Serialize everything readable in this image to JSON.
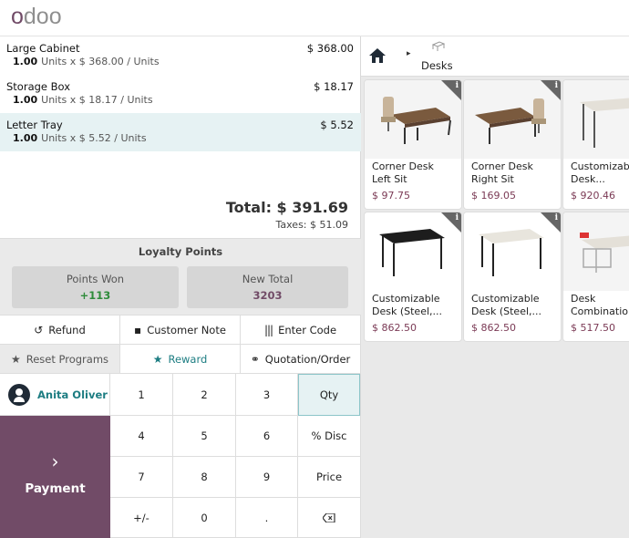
{
  "header": {
    "logo_text": "odoo"
  },
  "order": {
    "lines": [
      {
        "name": "Large Cabinet",
        "price": "$ 368.00",
        "qty": "1.00",
        "detail": "Units x $ 368.00 / Units"
      },
      {
        "name": "Storage Box",
        "price": "$ 18.17",
        "qty": "1.00",
        "detail": "Units x $ 18.17 / Units"
      },
      {
        "name": "Letter Tray",
        "price": "$ 5.52",
        "qty": "1.00",
        "detail": "Units x $ 5.52 / Units"
      }
    ],
    "total": "Total: $ 391.69",
    "taxes": "Taxes: $ 51.09"
  },
  "loyalty": {
    "title": "Loyalty Points",
    "points_won_label": "Points Won",
    "points_won_value": "+113",
    "new_total_label": "New Total",
    "new_total_value": "3203"
  },
  "controls": {
    "refund": "Refund",
    "customer_note": "Customer Note",
    "enter_code": "Enter Code",
    "reset_programs": "Reset Programs",
    "reward": "Reward",
    "quotation_order": "Quotation/Order"
  },
  "customer": {
    "name": "Anita Oliver"
  },
  "payment": {
    "label": "Payment"
  },
  "numpad": {
    "k1": "1",
    "k2": "2",
    "k3": "3",
    "qty": "Qty",
    "k4": "4",
    "k5": "5",
    "k6": "6",
    "disc": "% Disc",
    "k7": "7",
    "k8": "8",
    "k9": "9",
    "price": "Price",
    "plusminus": "+/-",
    "k0": "0",
    "dot": "."
  },
  "breadcrumb": {
    "category": "Desks"
  },
  "products": [
    {
      "name1": "Corner Desk",
      "name2": "Left Sit",
      "price": "$ 97.75"
    },
    {
      "name1": "Corner Desk",
      "name2": "Right Sit",
      "price": "$ 169.05"
    },
    {
      "name1": "Customizab",
      "name2": "Desk...",
      "price": "$ 920.46"
    },
    {
      "name1": "Customizable",
      "name2": "Desk (Steel,...",
      "price": "$ 862.50"
    },
    {
      "name1": "Customizable",
      "name2": "Desk (Steel,...",
      "price": "$ 862.50"
    },
    {
      "name1": "Desk",
      "name2": "Combinatio",
      "price": "$ 517.50"
    }
  ],
  "colors": {
    "brand": "#714b67",
    "teal": "#1d7d82",
    "points_won": "#2e8b3a",
    "new_total": "#714b67",
    "price": "#7b3a55",
    "selected_row": "#e6f2f3"
  },
  "icons": {
    "home": "home-icon",
    "refund": "undo-icon",
    "note": "note-icon",
    "code": "barcode-icon",
    "reset": "star-icon",
    "reward": "star-icon",
    "quotation": "link-icon",
    "backspace": "backspace-icon",
    "payment": "chevron-right-icon"
  }
}
